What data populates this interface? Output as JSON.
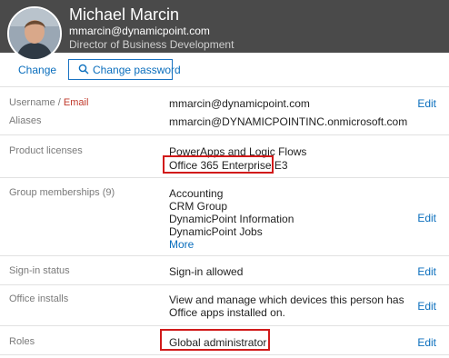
{
  "header": {
    "name": "Michael Marcin",
    "email": "mmarcin@dynamicpoint.com",
    "title": "Director of Business Development"
  },
  "actions": {
    "change_label": "Change",
    "change_password_label": "Change password"
  },
  "rows": {
    "username": {
      "label_main": "Username",
      "label_sep": " / ",
      "label_email": "Email",
      "value": "mmarcin@dynamicpoint.com",
      "edit": "Edit"
    },
    "aliases": {
      "label": "Aliases",
      "value": "mmarcin@DYNAMICPOINTINC.onmicrosoft.com"
    },
    "licenses": {
      "label": "Product licenses",
      "items": [
        "PowerApps and Logic Flows",
        "Office 365 Enterprise E3"
      ]
    },
    "groups": {
      "label": "Group memberships (9)",
      "items": [
        "Accounting",
        "CRM Group",
        "DynamicPoint Information",
        "DynamicPoint Jobs"
      ],
      "more": "More",
      "edit": "Edit"
    },
    "signin": {
      "label": "Sign-in status",
      "value": "Sign-in allowed",
      "edit": "Edit"
    },
    "office": {
      "label": "Office installs",
      "line1": "View and manage which devices this person has",
      "line2": "Office apps installed on.",
      "edit": "Edit"
    },
    "roles": {
      "label": "Roles",
      "value": "Global administrator",
      "edit": "Edit"
    }
  },
  "colors": {
    "header_bg": "#4a4a4a",
    "link": "#0a6ebd",
    "highlight": "#d11a1a"
  },
  "icons": {
    "change_password": "search-icon",
    "avatar": "user-photo"
  }
}
